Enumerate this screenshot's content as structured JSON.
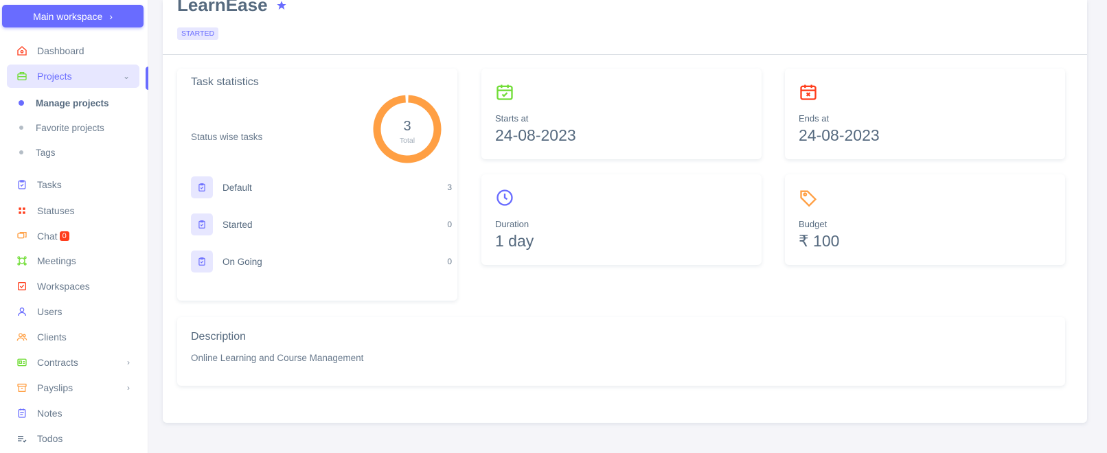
{
  "sidebar": {
    "workspace_label": "Main workspace",
    "items": [
      {
        "label": "Dashboard",
        "icon": "home-icon"
      },
      {
        "label": "Projects",
        "icon": "briefcase-icon"
      },
      {
        "label": "Tasks",
        "icon": "clipboard-check-icon"
      },
      {
        "label": "Statuses",
        "icon": "grid-dots-icon"
      },
      {
        "label": "Chat",
        "icon": "chat-icon",
        "badge": "0"
      },
      {
        "label": "Meetings",
        "icon": "shapes-icon"
      },
      {
        "label": "Workspaces",
        "icon": "checkbox-icon"
      },
      {
        "label": "Users",
        "icon": "user-icon"
      },
      {
        "label": "Clients",
        "icon": "users-icon"
      },
      {
        "label": "Contracts",
        "icon": "id-card-icon"
      },
      {
        "label": "Payslips",
        "icon": "archive-icon"
      },
      {
        "label": "Notes",
        "icon": "notes-icon"
      },
      {
        "label": "Todos",
        "icon": "list-check-icon"
      }
    ],
    "project_sub": [
      {
        "label": "Manage projects"
      },
      {
        "label": "Favorite projects"
      },
      {
        "label": "Tags"
      }
    ]
  },
  "project": {
    "title": "LearnEase",
    "status": "STARTED"
  },
  "task_stats": {
    "title": "Task statistics",
    "subtitle": "Status wise tasks",
    "total": "3",
    "total_label": "Total",
    "rows": [
      {
        "name": "Default",
        "count": "3"
      },
      {
        "name": "Started",
        "count": "0"
      },
      {
        "name": "On Going",
        "count": "0"
      }
    ]
  },
  "info": {
    "starts": {
      "label": "Starts at",
      "value": "24-08-2023"
    },
    "ends": {
      "label": "Ends at",
      "value": "24-08-2023"
    },
    "duration": {
      "label": "Duration",
      "value": "1 day"
    },
    "budget": {
      "label": "Budget",
      "value": "₹ 100"
    }
  },
  "description": {
    "title": "Description",
    "text": "Online Learning and Course Management"
  },
  "colors": {
    "primary": "#696cff",
    "success": "#71dd37",
    "danger": "#ff3e1d",
    "warning": "#ff9f43",
    "donut": "#ff9f43"
  }
}
